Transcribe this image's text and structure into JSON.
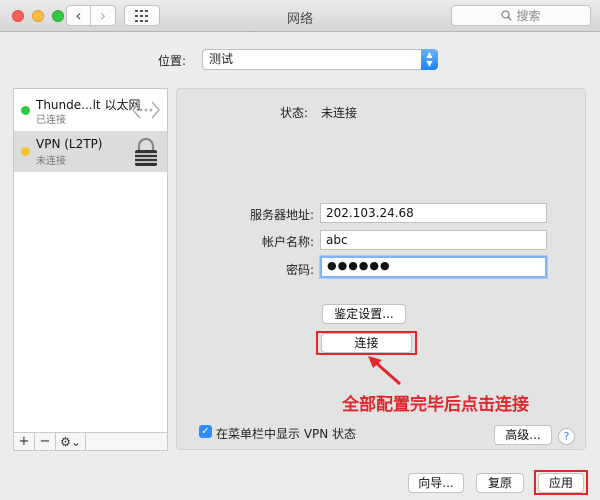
{
  "window": {
    "title": "网络"
  },
  "toolbar": {
    "back_glyph": "‹",
    "forward_glyph": "›",
    "search_placeholder": "搜索"
  },
  "location": {
    "label": "位置:",
    "value": "测试"
  },
  "services": [
    {
      "name": "Thunde...lt 以太网",
      "status": "已连接",
      "status_color": "#2bc840",
      "icon": "ethernet-icon"
    },
    {
      "name": "VPN (L2TP)",
      "status": "未连接",
      "status_color": "#f7bd34",
      "icon": "vpn-lock-icon"
    }
  ],
  "sidebar_controls": {
    "add": "+",
    "remove": "−",
    "gear": "⚙︎⌄"
  },
  "detail": {
    "status_label": "状态:",
    "status_value": "未连接",
    "server_label": "服务器地址:",
    "server_value": "202.103.24.68",
    "account_label": "帐户名称:",
    "account_value": "abc",
    "password_label": "密码:",
    "password_value": "●●●●●●",
    "auth_button": "鉴定设置...",
    "connect_button": "连接",
    "annotation": "全部配置完毕后点击连接",
    "show_in_menubar_label": "在菜单栏中显示 VPN 状态",
    "show_in_menubar_checked": true,
    "advanced_button": "高级...",
    "help_glyph": "?"
  },
  "footer": {
    "assist_button": "向导...",
    "revert_button": "复原",
    "apply_button": "应用"
  },
  "colors": {
    "annotation": "#e3262b",
    "accent": "#2f8cf8"
  }
}
